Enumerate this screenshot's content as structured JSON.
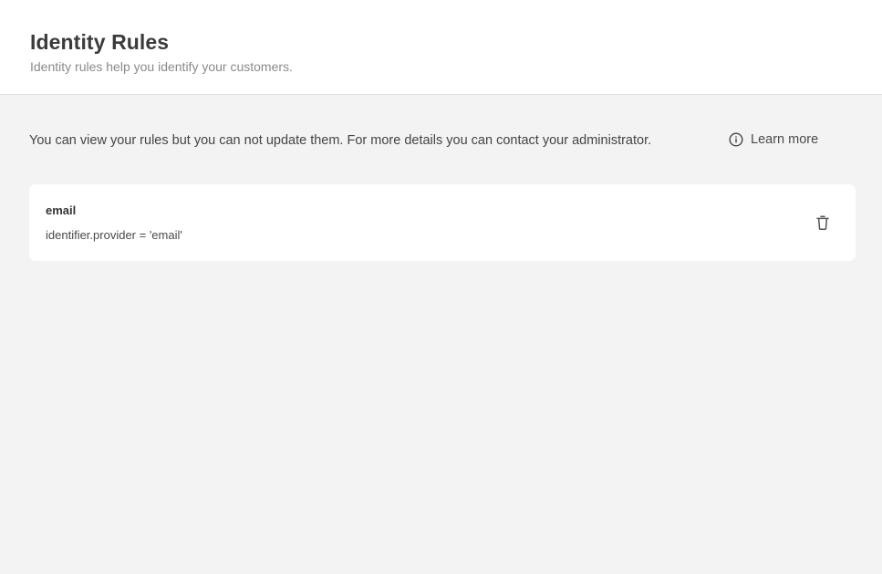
{
  "header": {
    "title": "Identity Rules",
    "subtitle": "Identity rules help you identify your customers."
  },
  "notice": {
    "text": "You can view your rules but you can not update them. For more details you can contact your administrator.",
    "learn_more_label": "Learn more",
    "learn_more_icon": "info-circle-icon"
  },
  "rules": [
    {
      "name": "email",
      "expression": "identifier.provider = 'email'",
      "delete_icon": "trash-icon"
    }
  ],
  "colors": {
    "page_background": "#f3f3f3",
    "card_background": "#ffffff",
    "title_text": "#3b3b3b",
    "subtitle_text": "#8a8a8a"
  }
}
